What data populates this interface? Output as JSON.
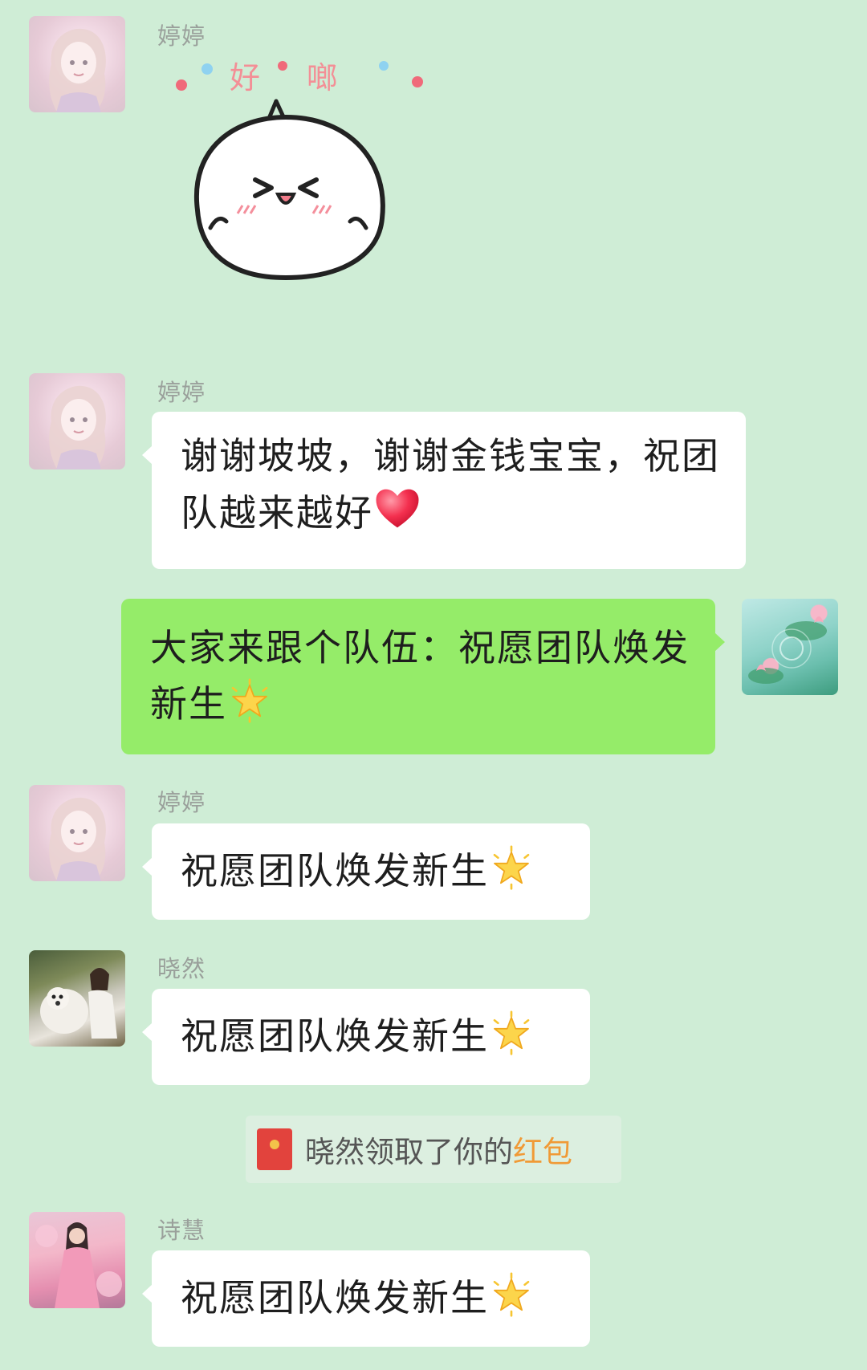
{
  "colors": {
    "background": "#cfedd6",
    "bubble_in": "#ffffff",
    "bubble_out": "#95ec69",
    "highlight": "#f09a36"
  },
  "sticker": {
    "text_1": "好",
    "text_2": "啷"
  },
  "messages": [
    {
      "sender": "婷婷",
      "text": "谢谢坡坡，谢谢金钱宝宝，祝团队越来越好",
      "emoji": "red-heart"
    },
    {
      "sender": "",
      "text": "大家来跟个队伍：祝愿团队焕发新生",
      "emoji": "glowing-star"
    },
    {
      "sender": "婷婷",
      "text": "祝愿团队焕发新生",
      "emoji": "glowing-star"
    },
    {
      "sender": "晓然",
      "text": "祝愿团队焕发新生",
      "emoji": "glowing-star"
    },
    {
      "sender": "诗慧",
      "text": "祝愿团队焕发新生",
      "emoji": "glowing-star"
    }
  ],
  "first_sender": "婷婷",
  "system_notice": {
    "text": "晓然领取了你的",
    "highlight": "红包"
  }
}
